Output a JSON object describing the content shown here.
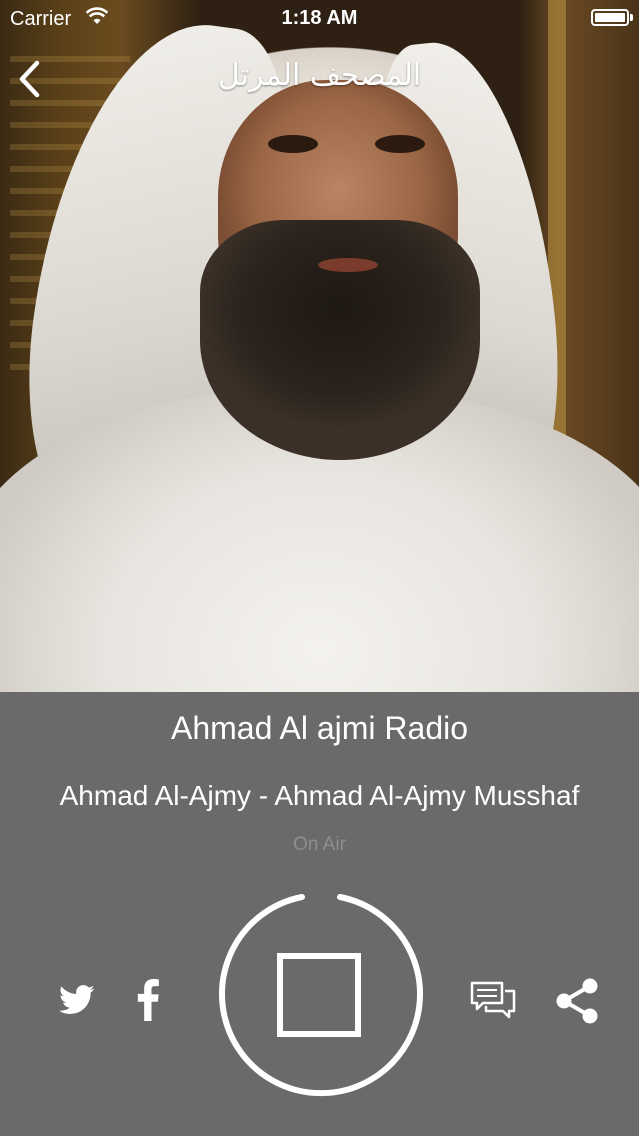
{
  "status_bar": {
    "carrier": "Carrier",
    "time": "1:18 AM"
  },
  "nav": {
    "title": "المصحف المرتل",
    "back_icon": "chevron-left-icon"
  },
  "player": {
    "station_name": "Ahmad Al ajmi Radio",
    "track": "Ahmad Al-Ajmy - Ahmad Al-Ajmy Musshaf",
    "status": "On Air",
    "control_icon": "stop-icon"
  },
  "actions": {
    "twitter_icon": "twitter-icon",
    "facebook_icon": "facebook-icon",
    "comments_icon": "comments-icon",
    "share_icon": "share-icon"
  },
  "colors": {
    "panel_background": "#6a6a6a",
    "text_primary": "#ffffff",
    "text_muted": "#8e8e8e"
  }
}
